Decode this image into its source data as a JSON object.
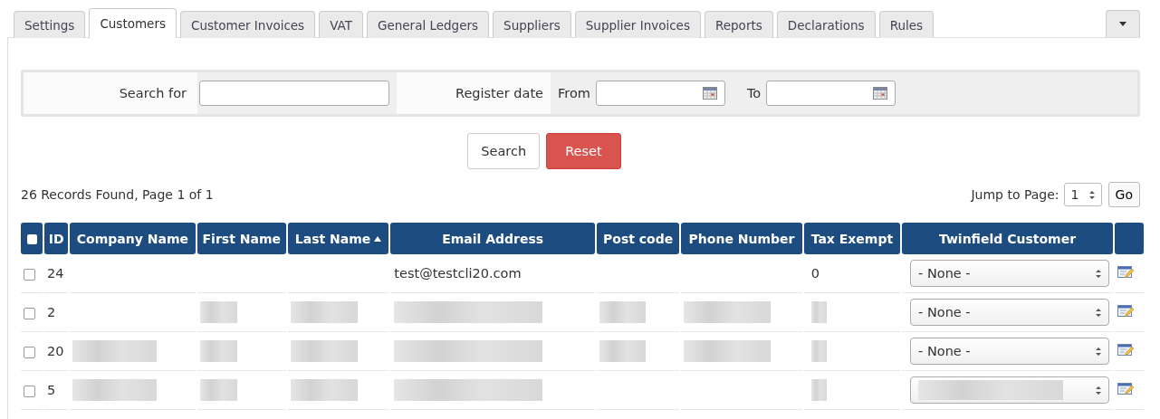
{
  "tabs": [
    {
      "label": "Settings",
      "selected": false
    },
    {
      "label": "Customers",
      "selected": true
    },
    {
      "label": "Customer Invoices",
      "selected": false
    },
    {
      "label": "VAT",
      "selected": false
    },
    {
      "label": "General Ledgers",
      "selected": false
    },
    {
      "label": "Suppliers",
      "selected": false
    },
    {
      "label": "Supplier Invoices",
      "selected": false
    },
    {
      "label": "Reports",
      "selected": false
    },
    {
      "label": "Declarations",
      "selected": false
    },
    {
      "label": "Rules",
      "selected": false
    }
  ],
  "filter": {
    "search_label": "Search for",
    "register_label": "Register date",
    "from_label": "From",
    "to_label": "To"
  },
  "buttons": {
    "search": "Search",
    "reset": "Reset"
  },
  "summary": "26 Records Found, Page 1 of 1",
  "jump": {
    "label": "Jump to Page:",
    "page": "1",
    "go": "Go"
  },
  "table": {
    "select_all_checked": false,
    "columns": [
      {
        "label": "ID",
        "sorted": false
      },
      {
        "label": "Company Name",
        "sorted": false
      },
      {
        "label": "First Name",
        "sorted": false
      },
      {
        "label": "Last Name",
        "sorted": true
      },
      {
        "label": "Email Address",
        "sorted": false
      },
      {
        "label": "Post code",
        "sorted": false
      },
      {
        "label": "Phone Number",
        "sorted": false
      },
      {
        "label": "Tax Exempt",
        "sorted": false
      },
      {
        "label": "Twinfield Customer",
        "sorted": false
      }
    ],
    "rows": [
      {
        "checked": false,
        "cells": [
          {
            "kind": "text",
            "text": "24"
          },
          {
            "kind": "empty"
          },
          {
            "kind": "empty"
          },
          {
            "kind": "empty"
          },
          {
            "kind": "text",
            "text": "test@testcli20.com"
          },
          {
            "kind": "empty"
          },
          {
            "kind": "empty"
          },
          {
            "kind": "text",
            "text": "0"
          },
          {
            "kind": "select",
            "text": "- None -"
          }
        ]
      },
      {
        "checked": false,
        "cells": [
          {
            "kind": "text",
            "text": "2"
          },
          {
            "kind": "empty"
          },
          {
            "kind": "redacted"
          },
          {
            "kind": "redacted"
          },
          {
            "kind": "redacted"
          },
          {
            "kind": "redacted"
          },
          {
            "kind": "redacted"
          },
          {
            "kind": "redacted"
          },
          {
            "kind": "select",
            "text": "- None -"
          }
        ]
      },
      {
        "checked": false,
        "cells": [
          {
            "kind": "text",
            "text": "20"
          },
          {
            "kind": "redacted"
          },
          {
            "kind": "redacted"
          },
          {
            "kind": "redacted"
          },
          {
            "kind": "redacted"
          },
          {
            "kind": "redacted"
          },
          {
            "kind": "redacted"
          },
          {
            "kind": "redacted"
          },
          {
            "kind": "select",
            "text": "- None -"
          }
        ]
      },
      {
        "checked": false,
        "cells": [
          {
            "kind": "text",
            "text": "5"
          },
          {
            "kind": "redacted"
          },
          {
            "kind": "redacted"
          },
          {
            "kind": "redacted"
          },
          {
            "kind": "redacted"
          },
          {
            "kind": "empty"
          },
          {
            "kind": "empty"
          },
          {
            "kind": "redacted"
          },
          {
            "kind": "redacted-select"
          }
        ]
      }
    ]
  }
}
